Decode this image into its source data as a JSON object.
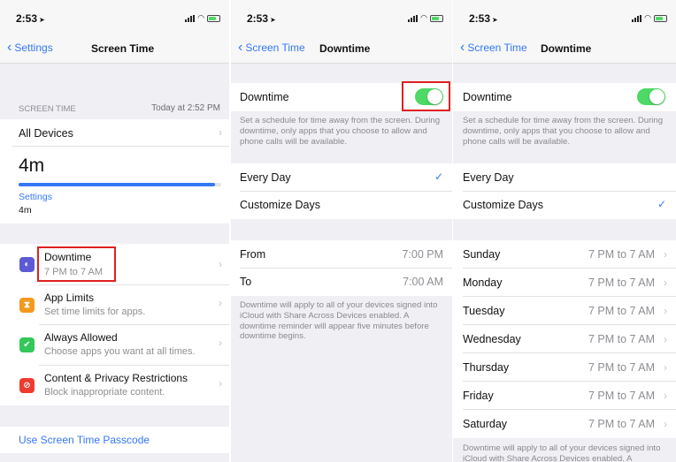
{
  "status_time": "2:53",
  "colors": {
    "accent": "#3478f6",
    "toggle_on": "#4cd964",
    "highlight": "#e02020"
  },
  "screen1": {
    "back_label": "Settings",
    "title": "Screen Time",
    "section_header": "SCREEN TIME",
    "section_timestamp": "Today at 2:52 PM",
    "all_devices": "All Devices",
    "total_time": "4m",
    "usage_fraction": 0.97,
    "bar_category": "Settings",
    "bar_category_time": "4m",
    "menu": [
      {
        "title": "Downtime",
        "subtitle": "7 PM to 7 AM",
        "icon": "downtime-icon",
        "icon_color": "#5b5bd6"
      },
      {
        "title": "App Limits",
        "subtitle": "Set time limits for apps.",
        "icon": "hourglass-icon",
        "icon_color": "#f39a1e"
      },
      {
        "title": "Always Allowed",
        "subtitle": "Choose apps you want at all times.",
        "icon": "check-badge-icon",
        "icon_color": "#34c759"
      },
      {
        "title": "Content & Privacy Restrictions",
        "subtitle": "Block inappropriate content.",
        "icon": "no-entry-icon",
        "icon_color": "#ee3b30"
      }
    ],
    "passcode_link": "Use Screen Time Passcode"
  },
  "screen2": {
    "back_label": "Screen Time",
    "title": "Downtime",
    "toggle_label": "Downtime",
    "toggle_on": true,
    "description": "Set a schedule for time away from the screen. During downtime, only apps that you choose to allow and phone calls will be available.",
    "options": [
      "Every Day",
      "Customize Days"
    ],
    "selected_option": "Every Day",
    "from_label": "From",
    "from_value": "7:00 PM",
    "to_label": "To",
    "to_value": "7:00 AM",
    "footnote": "Downtime will apply to all of your devices signed into iCloud with Share Across Devices enabled. A downtime reminder will appear five minutes before downtime begins."
  },
  "screen3": {
    "back_label": "Screen Time",
    "title": "Downtime",
    "toggle_label": "Downtime",
    "toggle_on": true,
    "description": "Set a schedule for time away from the screen. During downtime, only apps that you choose to allow and phone calls will be available.",
    "options": [
      "Every Day",
      "Customize Days"
    ],
    "selected_option": "Customize Days",
    "days": [
      {
        "day": "Sunday",
        "range": "7 PM to 7 AM"
      },
      {
        "day": "Monday",
        "range": "7 PM to 7 AM"
      },
      {
        "day": "Tuesday",
        "range": "7 PM to 7 AM"
      },
      {
        "day": "Wednesday",
        "range": "7 PM to 7 AM"
      },
      {
        "day": "Thursday",
        "range": "7 PM to 7 AM"
      },
      {
        "day": "Friday",
        "range": "7 PM to 7 AM"
      },
      {
        "day": "Saturday",
        "range": "7 PM to 7 AM"
      }
    ],
    "footnote": "Downtime will apply to all of your devices signed into iCloud with Share Across Devices enabled. A"
  }
}
